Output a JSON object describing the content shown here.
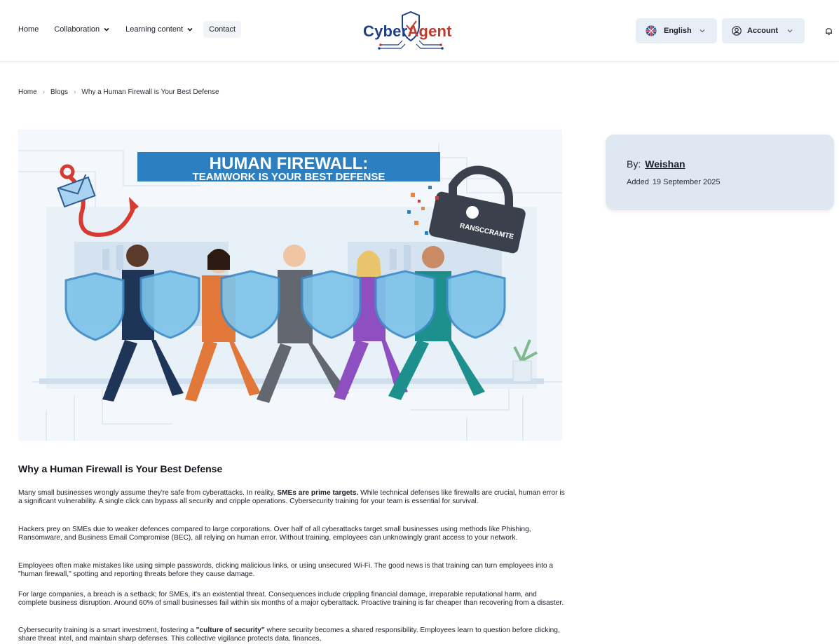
{
  "nav": {
    "home": "Home",
    "collaboration": "Collaboration",
    "learning": "Learning content",
    "contact": "Contact"
  },
  "logo": {
    "part1": "Cyber",
    "part2": "Agent"
  },
  "language": {
    "label": "English"
  },
  "account": {
    "label": "Account"
  },
  "breadcrumb": {
    "home": "Home",
    "blogs": "Blogs",
    "current": "Why a Human Firewall is Your Best Defense"
  },
  "hero": {
    "headline_1": "HUMAN FIREWALL:",
    "headline_2": "TEAMWORK IS YOUR BEST DEFENSE",
    "lock_text": "RANSCCRAMTE"
  },
  "author": {
    "by_label": "By:",
    "name": "Weishan",
    "added_label": "Added",
    "date": "19 September 2025"
  },
  "article": {
    "title": "Why a Human Firewall is Your Best Defense",
    "p1_a": "Many small businesses wrongly assume they're safe from cyberattacks. In reality, ",
    "p1_b": "SMEs are prime targets.",
    "p1_c": " While technical defenses like firewalls are crucial, human error is a significant vulnerability. A single click can bypass all security and cripple operations. Cybersecurity training for your team is essential for survival.",
    "p2": "Hackers prey on SMEs due to weaker defences compared to large corporations. Over half of all cyberattacks target small businesses using methods like Phishing, Ransomware, and Business Email Compromise (BEC), all relying on human error. Without training, employees can unknowingly grant access to your network.",
    "p3": "Employees often make mistakes like using simple passwords, clicking malicious links, or using unsecured Wi-Fi. The good news is that training can turn employees into a \"human firewall,\" spotting and reporting threats before they cause damage.",
    "p4": "For large companies, a breach is a setback; for SMEs, it's an existential threat. Consequences include crippling financial damage, irreparable reputational harm, and complete business disruption. Around 60% of small businesses fail within six months of a major cyberattack. Proactive training is far cheaper than recovering from a disaster.",
    "p5_a": "Cybersecurity training is a smart investment, fostering a ",
    "p5_b": "\"culture of security\"",
    "p5_c": " where security becomes a shared responsibility. Employees learn to question before clicking, share threat intel, and maintain sharp defenses. This collective vigilance protects data, finances,"
  },
  "colors": {
    "brand_blue": "#1f3f8a",
    "brand_red": "#c0392b",
    "button_bg": "#e7eef6",
    "card_bg": "#dfe7f0"
  }
}
